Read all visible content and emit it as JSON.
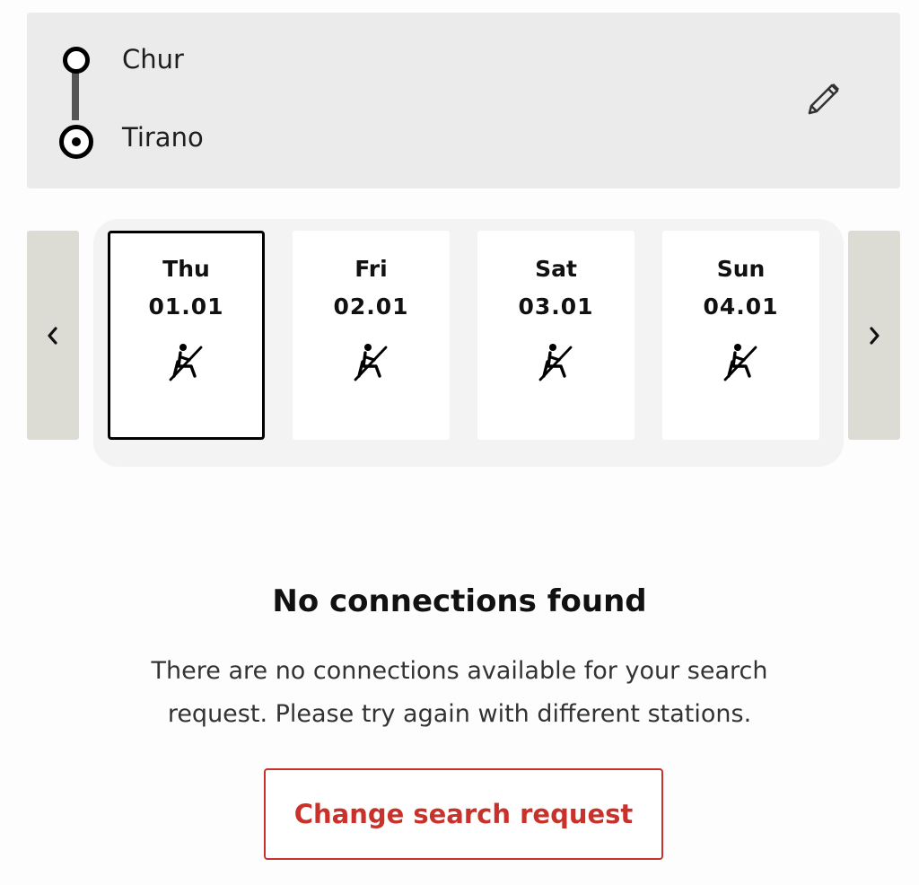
{
  "route": {
    "origin": "Chur",
    "destination": "Tirano",
    "edit_icon": "pencil-icon"
  },
  "date_selector": {
    "prev_icon": "chevron-left-icon",
    "next_icon": "chevron-right-icon",
    "days": [
      {
        "day": "Thu",
        "date": "01.01",
        "selected": true,
        "icon": "no-seat-reservation-icon"
      },
      {
        "day": "Fri",
        "date": "02.01",
        "selected": false,
        "icon": "no-seat-reservation-icon"
      },
      {
        "day": "Sat",
        "date": "03.01",
        "selected": false,
        "icon": "no-seat-reservation-icon"
      },
      {
        "day": "Sun",
        "date": "04.01",
        "selected": false,
        "icon": "no-seat-reservation-icon"
      }
    ]
  },
  "empty_state": {
    "title": "No connections found",
    "message": "There are no connections available for your search request. Please try again with different stations.",
    "button_label": "Change search request"
  },
  "colors": {
    "accent": "#c8322a",
    "panel": "#ebebeb",
    "nav_arrow": "#dcdbd4"
  }
}
